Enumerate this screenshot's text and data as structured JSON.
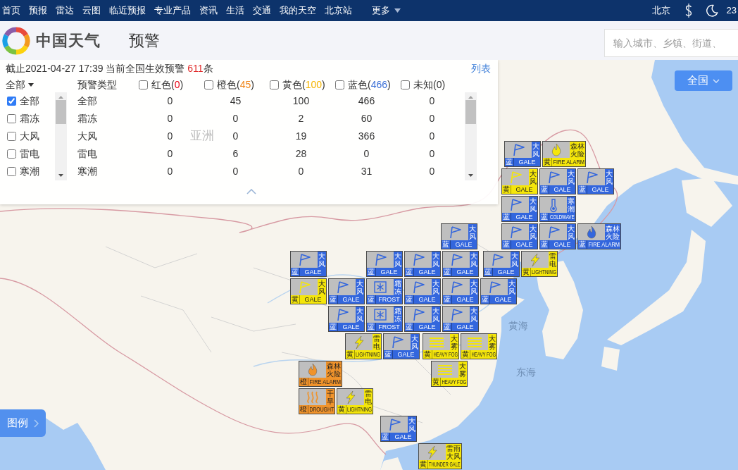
{
  "top_nav": {
    "items": [
      "首页",
      "预报",
      "雷达",
      "云图",
      "临近预报",
      "专业产品",
      "资讯",
      "生活",
      "交通",
      "我的天空",
      "北京站"
    ],
    "more": "更多",
    "city": "北京",
    "temperature": "23"
  },
  "header": {
    "logo_text": "中国天气",
    "page_title": "预警",
    "search": {
      "placeholder": "输入城市、乡镇、街道、"
    }
  },
  "panel": {
    "summary": {
      "before": "截止2021-04-27 17:39 当前全国生效预警 ",
      "count": "611",
      "after": "条"
    },
    "list_link": "列表",
    "scope_dropdown": "全部",
    "type_header": "预警类型",
    "level_filters": [
      {
        "label": "红色(",
        "count": "0",
        "close": ")",
        "color": "#e60012",
        "checked": false
      },
      {
        "label": "橙色(",
        "count": "45",
        "close": ")",
        "color": "#f08519",
        "checked": false
      },
      {
        "label": "黄色(",
        "count": "100",
        "close": ")",
        "color": "#f5b400",
        "checked": false
      },
      {
        "label": "蓝色(",
        "count": "466",
        "close": ")",
        "color": "#3b6fd6",
        "checked": false
      },
      {
        "label": "未知(",
        "count": "0",
        "close": ")",
        "color": "#333333",
        "checked": false
      }
    ],
    "type_options": [
      {
        "label": "全部",
        "checked": true
      },
      {
        "label": "霜冻",
        "checked": false
      },
      {
        "label": "大风",
        "checked": false
      },
      {
        "label": "雷电",
        "checked": false
      },
      {
        "label": "寒潮",
        "checked": false
      }
    ],
    "rows": [
      {
        "type": "全部",
        "counts": [
          "0",
          "45",
          "100",
          "466",
          "0"
        ]
      },
      {
        "type": "霜冻",
        "counts": [
          "0",
          "0",
          "2",
          "60",
          "0"
        ]
      },
      {
        "type": "大风",
        "counts": [
          "0",
          "0",
          "19",
          "366",
          "0"
        ]
      },
      {
        "type": "雷电",
        "counts": [
          "0",
          "6",
          "28",
          "0",
          "0"
        ]
      },
      {
        "type": "寒潮",
        "counts": [
          "0",
          "0",
          "0",
          "31",
          "0"
        ]
      }
    ]
  },
  "region_button": "全国",
  "legend_tab": "图例",
  "map_labels": [
    "亚洲",
    "黄海",
    "东海"
  ],
  "warnings": [
    {
      "kind": "gale",
      "name": "大风",
      "grade": "蓝",
      "english": "GALE",
      "color": "#3366dd"
    },
    {
      "kind": "fire",
      "name": "森林火险",
      "grade": "黄",
      "english": "FIRE ALARM",
      "color": "#f5e60a"
    },
    {
      "kind": "gale",
      "name": "大风",
      "grade": "黄",
      "english": "GALE",
      "color": "#f5e60a"
    },
    {
      "kind": "gale",
      "name": "大风",
      "grade": "蓝",
      "english": "GALE",
      "color": "#3366dd"
    },
    {
      "kind": "gale",
      "name": "大风",
      "grade": "蓝",
      "english": "GALE",
      "color": "#3366dd"
    },
    {
      "kind": "gale",
      "name": "大风",
      "grade": "蓝",
      "english": "GALE",
      "color": "#3366dd"
    },
    {
      "kind": "coldwave",
      "name": "寒潮",
      "grade": "蓝",
      "english": "COLDWAVE",
      "color": "#3366dd"
    },
    {
      "kind": "gale",
      "name": "大风",
      "grade": "蓝",
      "english": "GALE",
      "color": "#3366dd"
    },
    {
      "kind": "gale",
      "name": "大风",
      "grade": "蓝",
      "english": "GALE",
      "color": "#3366dd"
    },
    {
      "kind": "gale",
      "name": "大风",
      "grade": "蓝",
      "english": "GALE",
      "color": "#3366dd"
    },
    {
      "kind": "fire",
      "name": "森林火险",
      "grade": "蓝",
      "english": "FIRE ALARM",
      "color": "#3366dd"
    },
    {
      "kind": "gale",
      "name": "大风",
      "grade": "蓝",
      "english": "GALE",
      "color": "#3366dd"
    },
    {
      "kind": "gale",
      "name": "大风",
      "grade": "蓝",
      "english": "GALE",
      "color": "#3366dd"
    },
    {
      "kind": "gale",
      "name": "大风",
      "grade": "蓝",
      "english": "GALE",
      "color": "#3366dd"
    },
    {
      "kind": "gale",
      "name": "大风",
      "grade": "蓝",
      "english": "GALE",
      "color": "#3366dd"
    },
    {
      "kind": "gale",
      "name": "大风",
      "grade": "蓝",
      "english": "GALE",
      "color": "#3366dd"
    },
    {
      "kind": "lightning",
      "name": "雷电",
      "grade": "黄",
      "english": "LIGHTNING",
      "color": "#f5e60a"
    },
    {
      "kind": "gale",
      "name": "大风",
      "grade": "黄",
      "english": "GALE",
      "color": "#f5e60a"
    },
    {
      "kind": "gale",
      "name": "大风",
      "grade": "蓝",
      "english": "GALE",
      "color": "#3366dd"
    },
    {
      "kind": "frost",
      "name": "霜冻",
      "grade": "蓝",
      "english": "FROST",
      "color": "#3366dd"
    },
    {
      "kind": "gale",
      "name": "大风",
      "grade": "蓝",
      "english": "GALE",
      "color": "#3366dd"
    },
    {
      "kind": "gale",
      "name": "大风",
      "grade": "蓝",
      "english": "GALE",
      "color": "#3366dd"
    },
    {
      "kind": "gale",
      "name": "大风",
      "grade": "蓝",
      "english": "GALE",
      "color": "#3366dd"
    },
    {
      "kind": "gale",
      "name": "大风",
      "grade": "蓝",
      "english": "GALE",
      "color": "#3366dd"
    },
    {
      "kind": "frost",
      "name": "霜冻",
      "grade": "蓝",
      "english": "FROST",
      "color": "#3366dd"
    },
    {
      "kind": "gale",
      "name": "大风",
      "grade": "蓝",
      "english": "GALE",
      "color": "#3366dd"
    },
    {
      "kind": "gale",
      "name": "大风",
      "grade": "蓝",
      "english": "GALE",
      "color": "#3366dd"
    },
    {
      "kind": "lightning",
      "name": "雷电",
      "grade": "黄",
      "english": "LIGHTNING",
      "color": "#f5e60a"
    },
    {
      "kind": "gale",
      "name": "大风",
      "grade": "蓝",
      "english": "GALE",
      "color": "#3366dd"
    },
    {
      "kind": "fog",
      "name": "大雾",
      "grade": "黄",
      "english": "HEAVY FOG",
      "color": "#f5e60a"
    },
    {
      "kind": "fog",
      "name": "大雾",
      "grade": "黄",
      "english": "HEAVY FOG",
      "color": "#f5e60a"
    },
    {
      "kind": "fire",
      "name": "森林火险",
      "grade": "橙",
      "english": "FIRE ALARM",
      "color": "#f0932b"
    },
    {
      "kind": "fog",
      "name": "大雾",
      "grade": "黄",
      "english": "HEAVY FOG",
      "color": "#f5e60a"
    },
    {
      "kind": "drought",
      "name": "干旱",
      "grade": "橙",
      "english": "DROUGHT",
      "color": "#f0932b"
    },
    {
      "kind": "lightning",
      "name": "雷电",
      "grade": "黄",
      "english": "LIGHTNING",
      "color": "#f5e60a"
    },
    {
      "kind": "gale",
      "name": "大风",
      "grade": "蓝",
      "english": "GALE",
      "color": "#3366dd"
    },
    {
      "kind": "thunder_gale",
      "name": "雷雨大风",
      "grade": "黄",
      "english": "THUNDER GALE",
      "color": "#f5e60a"
    }
  ]
}
